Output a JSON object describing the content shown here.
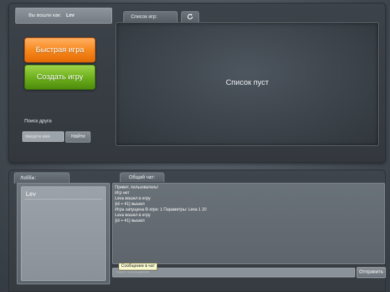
{
  "user": {
    "label": "Вы вошли как:",
    "name": "Lev"
  },
  "actions": {
    "quick_game": "Быстрая игра",
    "create_game": "Создать игру"
  },
  "friend_search": {
    "label": "Поиск друга",
    "placeholder": "Введите имя",
    "find_label": "Найти"
  },
  "games": {
    "tab_label": "Список игр:",
    "refresh_icon": "refresh-icon",
    "empty_text": "Список пуст"
  },
  "lobby": {
    "tab_label": "Лобби:",
    "players": [
      "Lev"
    ]
  },
  "chat": {
    "tab_label": "Общий чат:",
    "messages": [
      "Привет, пользователь!",
      "Игр нет",
      "Leva вошел в игру",
      "{id = 41} вышел",
      "Игра запущена В игре: 1 Параметры: Leva 1 20",
      "Leva вошел в игру",
      "{id = 41} вышел"
    ],
    "input_placeholder": "Текст сообщения",
    "send_label": "Отправить",
    "tooltip": "Сообщение в чат"
  }
}
